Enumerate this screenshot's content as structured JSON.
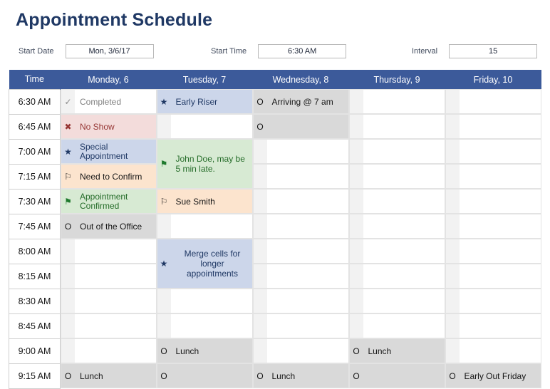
{
  "page": {
    "title": "Appointment Schedule"
  },
  "controls": {
    "start_date": {
      "label": "Start Date",
      "value": "Mon, 3/6/17"
    },
    "start_time": {
      "label": "Start Time",
      "value": "6:30 AM"
    },
    "interval": {
      "label": "Interval",
      "value": "15"
    }
  },
  "colors": {
    "header_blue": "#3c5a9a",
    "title_navy": "#1f3864",
    "fill_pink": "#f3dcdb",
    "fill_blue": "#ccd6ea",
    "fill_peach": "#fce4ce",
    "fill_green": "#d7ead3",
    "fill_gray": "#d9d9d9"
  },
  "table": {
    "headers": [
      "Time",
      "Monday, 6",
      "Tuesday, 7",
      "Wednesday, 8",
      "Thursday, 9",
      "Friday, 10"
    ],
    "times": [
      "6:30 AM",
      "6:45 AM",
      "7:00 AM",
      "7:15 AM",
      "7:30 AM",
      "7:45 AM",
      "8:00 AM",
      "8:15 AM",
      "8:30 AM",
      "8:45 AM",
      "9:00 AM",
      "9:15 AM"
    ],
    "rows": [
      {
        "time": "6:30 AM",
        "cells": [
          {
            "icon": "check-icon",
            "glyph": "✓",
            "text": "Completed",
            "fill": "f-white",
            "text_color": "t-gray",
            "icon_color": "i-gray"
          },
          {
            "icon": "star-icon",
            "glyph": "★",
            "text": "Early Riser",
            "fill": "f-blue",
            "text_color": "t-navy",
            "icon_color": "i-navy"
          },
          {
            "icon": "circle-icon",
            "glyph": "O",
            "text": "Arriving @ 7 am",
            "fill": "f-gray",
            "text_color": "t-black",
            "icon_color": "i-black"
          },
          {
            "icon": "",
            "glyph": "",
            "text": "",
            "fill": "f-white",
            "text_color": "t-black",
            "icon_color": "i-black"
          },
          {
            "icon": "",
            "glyph": "",
            "text": "",
            "fill": "f-white",
            "text_color": "t-black",
            "icon_color": "i-black"
          }
        ]
      },
      {
        "time": "6:45 AM",
        "cells": [
          {
            "icon": "x-icon",
            "glyph": "✖",
            "text": "No Show",
            "fill": "f-pink",
            "text_color": "t-red",
            "icon_color": "i-red"
          },
          {
            "icon": "",
            "glyph": "",
            "text": "",
            "fill": "f-white",
            "text_color": "t-black",
            "icon_color": "i-black"
          },
          {
            "icon": "circle-icon",
            "glyph": "O",
            "text": "",
            "fill": "f-gray",
            "text_color": "t-black",
            "icon_color": "i-black"
          },
          {
            "icon": "",
            "glyph": "",
            "text": "",
            "fill": "f-white",
            "text_color": "t-black",
            "icon_color": "i-black"
          },
          {
            "icon": "",
            "glyph": "",
            "text": "",
            "fill": "f-white",
            "text_color": "t-black",
            "icon_color": "i-black"
          }
        ]
      },
      {
        "time": "7:00 AM",
        "cells": [
          {
            "icon": "star-icon",
            "glyph": "★",
            "text": "Special Appointment",
            "fill": "f-blue",
            "text_color": "t-navy",
            "icon_color": "i-navy",
            "wrap": true
          },
          {
            "icon": "flag-filled-icon",
            "glyph": "⚑",
            "text": "John Doe, may be 5 min late.",
            "fill": "f-green",
            "text_color": "t-green",
            "icon_color": "i-green",
            "wrap": true,
            "rowspan": 2
          },
          {
            "icon": "",
            "glyph": "",
            "text": "",
            "fill": "f-white",
            "text_color": "t-black",
            "icon_color": "i-black"
          },
          {
            "icon": "",
            "glyph": "",
            "text": "",
            "fill": "f-white",
            "text_color": "t-black",
            "icon_color": "i-black"
          },
          {
            "icon": "",
            "glyph": "",
            "text": "",
            "fill": "f-white",
            "text_color": "t-black",
            "icon_color": "i-black"
          }
        ]
      },
      {
        "time": "7:15 AM",
        "cells": [
          {
            "icon": "flag-outline-icon",
            "glyph": "⚐",
            "text": "Need to Confirm",
            "fill": "f-peach",
            "text_color": "t-black",
            "icon_color": "i-black"
          },
          {
            "skip": true
          },
          {
            "icon": "",
            "glyph": "",
            "text": "",
            "fill": "f-white",
            "text_color": "t-black",
            "icon_color": "i-black"
          },
          {
            "icon": "",
            "glyph": "",
            "text": "",
            "fill": "f-white",
            "text_color": "t-black",
            "icon_color": "i-black"
          },
          {
            "icon": "",
            "glyph": "",
            "text": "",
            "fill": "f-white",
            "text_color": "t-black",
            "icon_color": "i-black"
          }
        ]
      },
      {
        "time": "7:30 AM",
        "cells": [
          {
            "icon": "flag-filled-icon",
            "glyph": "⚑",
            "text": "Appointment Confirmed",
            "fill": "f-green",
            "text_color": "t-green",
            "icon_color": "i-green",
            "wrap": true
          },
          {
            "icon": "flag-outline-icon",
            "glyph": "⚐",
            "text": "Sue Smith",
            "fill": "f-peach",
            "text_color": "t-black",
            "icon_color": "i-black"
          },
          {
            "icon": "",
            "glyph": "",
            "text": "",
            "fill": "f-white",
            "text_color": "t-black",
            "icon_color": "i-black"
          },
          {
            "icon": "",
            "glyph": "",
            "text": "",
            "fill": "f-white",
            "text_color": "t-black",
            "icon_color": "i-black"
          },
          {
            "icon": "",
            "glyph": "",
            "text": "",
            "fill": "f-white",
            "text_color": "t-black",
            "icon_color": "i-black"
          }
        ]
      },
      {
        "time": "7:45 AM",
        "cells": [
          {
            "icon": "circle-icon",
            "glyph": "O",
            "text": "Out of the Office",
            "fill": "f-gray",
            "text_color": "t-black",
            "icon_color": "i-black"
          },
          {
            "icon": "",
            "glyph": "",
            "text": "",
            "fill": "f-white",
            "text_color": "t-black",
            "icon_color": "i-black"
          },
          {
            "icon": "",
            "glyph": "",
            "text": "",
            "fill": "f-white",
            "text_color": "t-black",
            "icon_color": "i-black"
          },
          {
            "icon": "",
            "glyph": "",
            "text": "",
            "fill": "f-white",
            "text_color": "t-black",
            "icon_color": "i-black"
          },
          {
            "icon": "",
            "glyph": "",
            "text": "",
            "fill": "f-white",
            "text_color": "t-black",
            "icon_color": "i-black"
          }
        ]
      },
      {
        "time": "8:00 AM",
        "cells": [
          {
            "icon": "",
            "glyph": "",
            "text": "",
            "fill": "f-white",
            "text_color": "t-black",
            "icon_color": "i-black"
          },
          {
            "icon": "star-icon",
            "glyph": "★",
            "text": "Merge cells for longer appointments",
            "fill": "f-blue",
            "text_color": "t-navy",
            "icon_color": "i-navy",
            "wrap": true,
            "center": true,
            "rowspan": 2
          },
          {
            "icon": "",
            "glyph": "",
            "text": "",
            "fill": "f-white",
            "text_color": "t-black",
            "icon_color": "i-black"
          },
          {
            "icon": "",
            "glyph": "",
            "text": "",
            "fill": "f-white",
            "text_color": "t-black",
            "icon_color": "i-black"
          },
          {
            "icon": "",
            "glyph": "",
            "text": "",
            "fill": "f-white",
            "text_color": "t-black",
            "icon_color": "i-black"
          }
        ]
      },
      {
        "time": "8:15 AM",
        "cells": [
          {
            "icon": "",
            "glyph": "",
            "text": "",
            "fill": "f-white",
            "text_color": "t-black",
            "icon_color": "i-black"
          },
          {
            "skip": true
          },
          {
            "icon": "",
            "glyph": "",
            "text": "",
            "fill": "f-white",
            "text_color": "t-black",
            "icon_color": "i-black"
          },
          {
            "icon": "",
            "glyph": "",
            "text": "",
            "fill": "f-white",
            "text_color": "t-black",
            "icon_color": "i-black"
          },
          {
            "icon": "",
            "glyph": "",
            "text": "",
            "fill": "f-white",
            "text_color": "t-black",
            "icon_color": "i-black"
          }
        ]
      },
      {
        "time": "8:30 AM",
        "cells": [
          {
            "icon": "",
            "glyph": "",
            "text": "",
            "fill": "f-white",
            "text_color": "t-black",
            "icon_color": "i-black"
          },
          {
            "icon": "",
            "glyph": "",
            "text": "",
            "fill": "f-white",
            "text_color": "t-black",
            "icon_color": "i-black"
          },
          {
            "icon": "",
            "glyph": "",
            "text": "",
            "fill": "f-white",
            "text_color": "t-black",
            "icon_color": "i-black"
          },
          {
            "icon": "",
            "glyph": "",
            "text": "",
            "fill": "f-white",
            "text_color": "t-black",
            "icon_color": "i-black"
          },
          {
            "icon": "",
            "glyph": "",
            "text": "",
            "fill": "f-white",
            "text_color": "t-black",
            "icon_color": "i-black"
          }
        ]
      },
      {
        "time": "8:45 AM",
        "cells": [
          {
            "icon": "",
            "glyph": "",
            "text": "",
            "fill": "f-white",
            "text_color": "t-black",
            "icon_color": "i-black"
          },
          {
            "icon": "",
            "glyph": "",
            "text": "",
            "fill": "f-white",
            "text_color": "t-black",
            "icon_color": "i-black"
          },
          {
            "icon": "",
            "glyph": "",
            "text": "",
            "fill": "f-white",
            "text_color": "t-black",
            "icon_color": "i-black"
          },
          {
            "icon": "",
            "glyph": "",
            "text": "",
            "fill": "f-white",
            "text_color": "t-black",
            "icon_color": "i-black"
          },
          {
            "icon": "",
            "glyph": "",
            "text": "",
            "fill": "f-white",
            "text_color": "t-black",
            "icon_color": "i-black"
          }
        ]
      },
      {
        "time": "9:00 AM",
        "cells": [
          {
            "icon": "",
            "glyph": "",
            "text": "",
            "fill": "f-white",
            "text_color": "t-black",
            "icon_color": "i-black"
          },
          {
            "icon": "circle-icon",
            "glyph": "O",
            "text": "Lunch",
            "fill": "f-gray",
            "text_color": "t-black",
            "icon_color": "i-black"
          },
          {
            "icon": "",
            "glyph": "",
            "text": "",
            "fill": "f-white",
            "text_color": "t-black",
            "icon_color": "i-black"
          },
          {
            "icon": "circle-icon",
            "glyph": "O",
            "text": "Lunch",
            "fill": "f-gray",
            "text_color": "t-black",
            "icon_color": "i-black"
          },
          {
            "icon": "",
            "glyph": "",
            "text": "",
            "fill": "f-white",
            "text_color": "t-black",
            "icon_color": "i-black"
          }
        ]
      },
      {
        "time": "9:15 AM",
        "cells": [
          {
            "icon": "circle-icon",
            "glyph": "O",
            "text": "Lunch",
            "fill": "f-gray",
            "text_color": "t-black",
            "icon_color": "i-black"
          },
          {
            "icon": "circle-icon",
            "glyph": "O",
            "text": "",
            "fill": "f-gray",
            "text_color": "t-black",
            "icon_color": "i-black"
          },
          {
            "icon": "circle-icon",
            "glyph": "O",
            "text": "Lunch",
            "fill": "f-gray",
            "text_color": "t-black",
            "icon_color": "i-black"
          },
          {
            "icon": "circle-icon",
            "glyph": "O",
            "text": "",
            "fill": "f-gray",
            "text_color": "t-black",
            "icon_color": "i-black"
          },
          {
            "icon": "circle-icon",
            "glyph": "O",
            "text": "Early Out Friday",
            "fill": "f-gray",
            "text_color": "t-black",
            "icon_color": "i-black"
          }
        ]
      }
    ]
  }
}
